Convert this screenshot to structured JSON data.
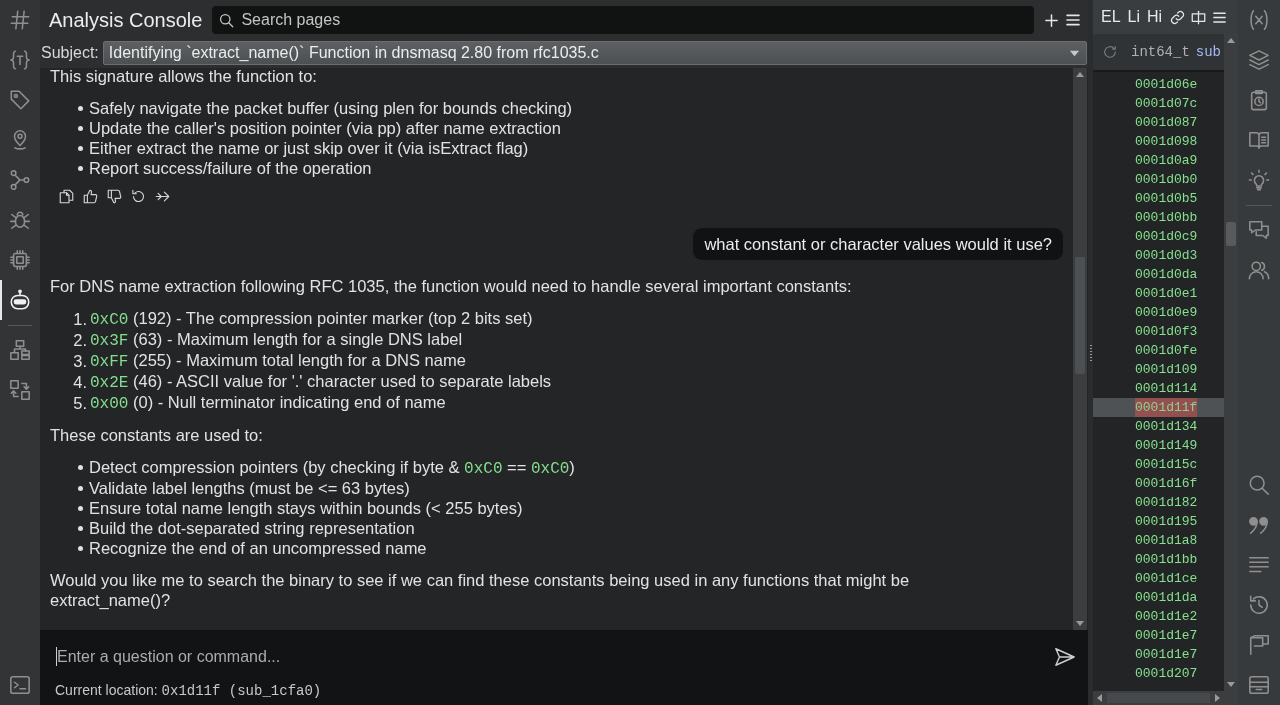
{
  "activity_bar": {
    "top": [
      {
        "selected": false
      },
      {
        "selected": false
      },
      {
        "selected": false
      },
      {
        "selected": false
      },
      {
        "selected": false
      },
      {
        "selected": false
      },
      {
        "selected": false
      },
      {
        "selected": true
      }
    ],
    "middle": [
      {
        "selected": false
      },
      {
        "selected": false
      }
    ],
    "bottom": [
      {
        "selected": false
      }
    ]
  },
  "console": {
    "title": "Analysis Console",
    "search": {
      "placeholder": "Search pages"
    },
    "subject": {
      "label": "Subject:",
      "value": "Identifying `extract_name()` Function in dnsmasq 2.80 from rfc1035.c"
    }
  },
  "messages": [
    {
      "kind": "assistant",
      "actions": true,
      "blocks": [
        {
          "kind": "paragraph",
          "parts": [
            {
              "kind": "text",
              "text": "This signature allows the function to:"
            }
          ]
        },
        {
          "kind": "bullets",
          "items": [
            {
              "parts": [
                {
                  "kind": "text",
                  "text": "Safely navigate the packet buffer (using plen for bounds checking)"
                }
              ]
            },
            {
              "parts": [
                {
                  "kind": "text",
                  "text": "Update the caller's position pointer (via pp) after name extraction"
                }
              ]
            },
            {
              "parts": [
                {
                  "kind": "text",
                  "text": "Either extract the name or just skip over it (via isExtract flag)"
                }
              ]
            },
            {
              "parts": [
                {
                  "kind": "text",
                  "text": "Report success/failure of the operation"
                }
              ]
            }
          ]
        }
      ]
    },
    {
      "kind": "user",
      "text": "what constant or character values would it use?"
    },
    {
      "kind": "assistant",
      "blocks": [
        {
          "kind": "paragraph",
          "parts": [
            {
              "kind": "text",
              "text": "For DNS name extraction following RFC 1035, the function would need to handle several important constants:"
            }
          ]
        },
        {
          "kind": "numbered",
          "items": [
            {
              "number": "1.",
              "parts": [
                {
                  "kind": "code",
                  "text": "0xC0"
                },
                {
                  "kind": "text",
                  "text": " (192) - The compression pointer marker (top 2 bits set)"
                }
              ]
            },
            {
              "number": "2.",
              "parts": [
                {
                  "kind": "code",
                  "text": "0x3F"
                },
                {
                  "kind": "text",
                  "text": " (63) - Maximum length for a single DNS label"
                }
              ]
            },
            {
              "number": "3.",
              "parts": [
                {
                  "kind": "code",
                  "text": "0xFF"
                },
                {
                  "kind": "text",
                  "text": " (255) - Maximum total length for a DNS name"
                }
              ]
            },
            {
              "number": "4.",
              "parts": [
                {
                  "kind": "code",
                  "text": "0x2E"
                },
                {
                  "kind": "text",
                  "text": " (46) - ASCII value for '.' character used to separate labels"
                }
              ]
            },
            {
              "number": "5.",
              "parts": [
                {
                  "kind": "code",
                  "text": "0x00"
                },
                {
                  "kind": "text",
                  "text": " (0) - Null terminator indicating end of name"
                }
              ]
            }
          ]
        },
        {
          "kind": "paragraph",
          "parts": [
            {
              "kind": "text",
              "text": "These constants are used to:"
            }
          ]
        },
        {
          "kind": "bullets",
          "items": [
            {
              "parts": [
                {
                  "kind": "text",
                  "text": "Detect compression pointers (by checking if byte & "
                },
                {
                  "kind": "code",
                  "text": "0xC0"
                },
                {
                  "kind": "text",
                  "text": " == "
                },
                {
                  "kind": "code",
                  "text": "0xC0"
                },
                {
                  "kind": "text",
                  "text": ")"
                }
              ]
            },
            {
              "parts": [
                {
                  "kind": "text",
                  "text": "Validate label lengths (must be <= 63 bytes)"
                }
              ]
            },
            {
              "parts": [
                {
                  "kind": "text",
                  "text": "Ensure total name length stays within bounds (< 255 bytes)"
                }
              ]
            },
            {
              "parts": [
                {
                  "kind": "text",
                  "text": "Build the dot-separated string representation"
                }
              ]
            },
            {
              "parts": [
                {
                  "kind": "text",
                  "text": "Recognize the end of an uncompressed name"
                }
              ]
            }
          ]
        },
        {
          "kind": "paragraph",
          "parts": [
            {
              "kind": "text",
              "text": "Would you like me to search the binary to see if we can find these constants being used in any functions that might be extract_name()?"
            }
          ]
        }
      ]
    }
  ],
  "input": {
    "placeholder": "Enter a question or command...",
    "focused": true
  },
  "status": {
    "label": "Current location:",
    "address": "0x1d11f",
    "function": "(sub_1cfa0)"
  },
  "side_panel": {
    "tabs": [
      {
        "label": "EL"
      },
      {
        "label": "Li"
      },
      {
        "label": "Hi"
      }
    ],
    "header": {
      "type": "int64_t",
      "name": "sub"
    },
    "addresses": [
      {
        "text": "0001d06e",
        "selected": false
      },
      {
        "text": "0001d07c",
        "selected": false
      },
      {
        "text": "0001d087",
        "selected": false
      },
      {
        "text": "0001d098",
        "selected": false
      },
      {
        "text": "0001d0a9",
        "selected": false
      },
      {
        "text": "0001d0b0",
        "selected": false
      },
      {
        "text": "0001d0b5",
        "selected": false
      },
      {
        "text": "0001d0bb",
        "selected": false
      },
      {
        "text": "0001d0c9",
        "selected": false
      },
      {
        "text": "0001d0d3",
        "selected": false
      },
      {
        "text": "0001d0da",
        "selected": false
      },
      {
        "text": "0001d0e1",
        "selected": false
      },
      {
        "text": "0001d0e9",
        "selected": false
      },
      {
        "text": "0001d0f3",
        "selected": false
      },
      {
        "text": "0001d0fe",
        "selected": false
      },
      {
        "text": "0001d109",
        "selected": false
      },
      {
        "text": "0001d114",
        "selected": false
      },
      {
        "text": "0001d11f",
        "selected": true
      },
      {
        "text": "0001d134",
        "selected": false
      },
      {
        "text": "0001d149",
        "selected": false
      },
      {
        "text": "0001d15c",
        "selected": false
      },
      {
        "text": "0001d16f",
        "selected": false
      },
      {
        "text": "0001d182",
        "selected": false
      },
      {
        "text": "0001d195",
        "selected": false
      },
      {
        "text": "0001d1a8",
        "selected": false
      },
      {
        "text": "0001d1bb",
        "selected": false
      },
      {
        "text": "0001d1ce",
        "selected": false
      },
      {
        "text": "0001d1da",
        "selected": false
      },
      {
        "text": "0001d1e2",
        "selected": false
      },
      {
        "text": "0001d1e7",
        "selected": false
      },
      {
        "text": "0001d1e7",
        "selected": false
      },
      {
        "text": "0001d207",
        "selected": false
      }
    ]
  }
}
